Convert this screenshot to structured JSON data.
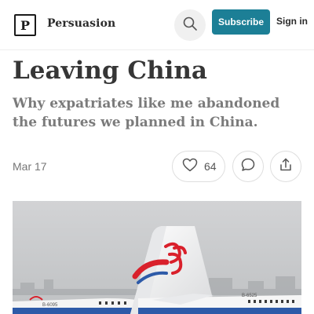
{
  "header": {
    "logo_letter": "P",
    "publication_name": "Persuasion",
    "search_icon": "search-icon",
    "subscribe_label": "Subscribe",
    "signin_label": "Sign in"
  },
  "article": {
    "title": "Leaving China",
    "subtitle": "Why expatriates like me abandoned the futures we planned in China.",
    "date": "Mar 17",
    "like_count": "64",
    "icons": {
      "like": "heart-icon",
      "comment": "comment-icon",
      "share": "share-icon"
    }
  },
  "hero_image": {
    "tail_registration_left": "B-6095",
    "tail_registration_right": "B-6525"
  },
  "colors": {
    "accent": "#1c7f96",
    "title": "#363636",
    "subtitle": "#7b7b7b",
    "meta": "#767676",
    "airline_red": "#d9202b"
  }
}
